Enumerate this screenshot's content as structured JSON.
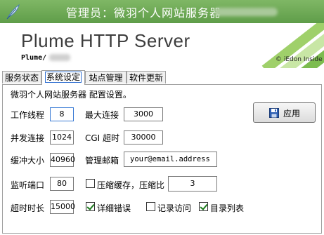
{
  "title_bar": {
    "title": "管理员：微羽个人网站服务器"
  },
  "banner": {
    "app_name": "Plume HTTP Server",
    "path": "Plume/",
    "copyright": "© iEdon Inside"
  },
  "tabs": [
    {
      "label": "服务状态"
    },
    {
      "label": "系统设定"
    },
    {
      "label": "站点管理"
    },
    {
      "label": "软件更新"
    }
  ],
  "settings": {
    "heading": "微羽个人网站服务器 配置设置。",
    "worker_threads": {
      "label": "工作线程",
      "value": "8"
    },
    "max_connections": {
      "label": "最大连接",
      "value": "3000"
    },
    "concurrent_connections": {
      "label": "并发连接",
      "value": "1024"
    },
    "cgi_timeout": {
      "label": "CGI 超时",
      "value": "30000"
    },
    "buffer_size": {
      "label": "缓冲大小",
      "value": "40960"
    },
    "admin_email": {
      "label": "管理邮箱",
      "value": "your@email.address"
    },
    "listen_port": {
      "label": "监听端口",
      "value": "80"
    },
    "compression": {
      "label": "压缩缓存，压缩比",
      "checked": false,
      "ratio": "3"
    },
    "timeout": {
      "label": "超时时长",
      "value": "15000"
    },
    "detailed_errors": {
      "label": "详细错误",
      "checked": true
    },
    "access_log": {
      "label": "记录访问",
      "checked": false
    },
    "directory_listing": {
      "label": "目录列表",
      "checked": true
    }
  },
  "apply_button": {
    "label": "应用"
  },
  "colors": {
    "title_bar": "#6aa654",
    "accent": "#2f6fd0",
    "check": "#1a7a1a"
  }
}
